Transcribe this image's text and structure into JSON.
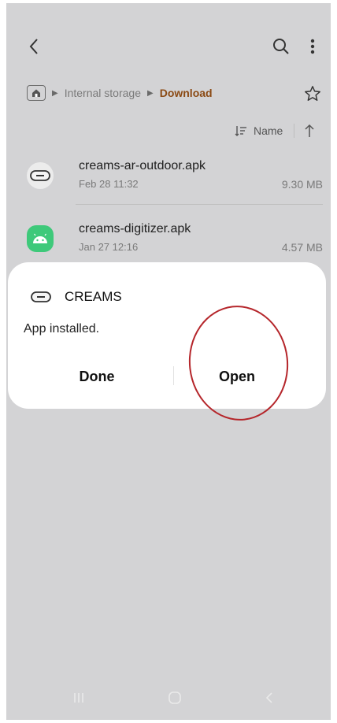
{
  "header": {
    "back_icon": "chevron-left-icon",
    "search_icon": "search-icon",
    "more_icon": "more-vertical-icon"
  },
  "breadcrumb": {
    "home_icon": "home-folder-icon",
    "items": [
      "Internal storage",
      "Download"
    ]
  },
  "sort": {
    "label": "Name",
    "direction": "ascending"
  },
  "files": [
    {
      "name": "creams-ar-outdoor.apk",
      "date": "Feb 28 11:32",
      "size": "9.30 MB",
      "icon": "creams-app-icon"
    },
    {
      "name": "creams-digitizer.apk",
      "date": "Jan 27 12:16",
      "size": "4.57 MB",
      "icon": "android-apk-icon"
    }
  ],
  "dialog": {
    "app_name": "CREAMS",
    "message": "App installed.",
    "done_label": "Done",
    "open_label": "Open"
  },
  "colors": {
    "background": "#d3d3d5",
    "accent": "#8b4a14",
    "android_green": "#3ec97a",
    "annotation_red": "#b5262b"
  }
}
